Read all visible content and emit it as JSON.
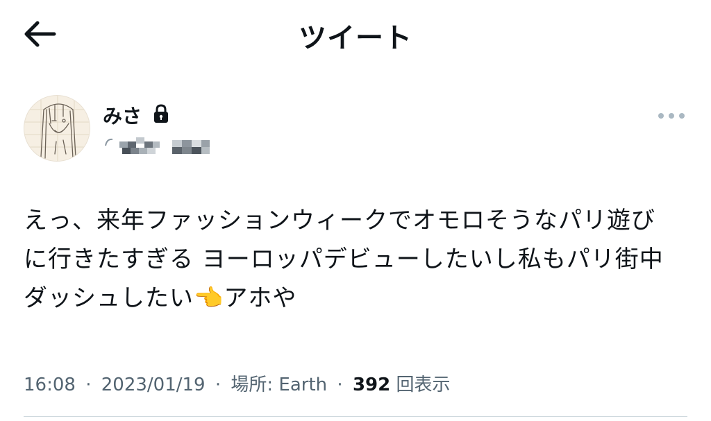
{
  "header": {
    "title": "ツイート",
    "back_icon": "arrow-left-icon"
  },
  "author": {
    "display_name": "みさ",
    "lock_icon": "lock-icon",
    "more_icon": "more-horizontal-icon"
  },
  "tweet": {
    "text": "えっ、来年ファッションウィークでオモロそうなパリ遊び\nに行きたすぎる ヨーロッパデビューしたいし私もパリ街中\nダッシュしたい👈アホや"
  },
  "meta": {
    "time": "16:08",
    "date": "2023/01/19",
    "location_label": "場所: Earth",
    "separator": "·",
    "view_count": "392",
    "view_label": "回表示"
  },
  "colors": {
    "text": "#0f1419",
    "secondary": "#536471",
    "divider": "#cfd9de",
    "icon_gray": "#aab8c2"
  }
}
